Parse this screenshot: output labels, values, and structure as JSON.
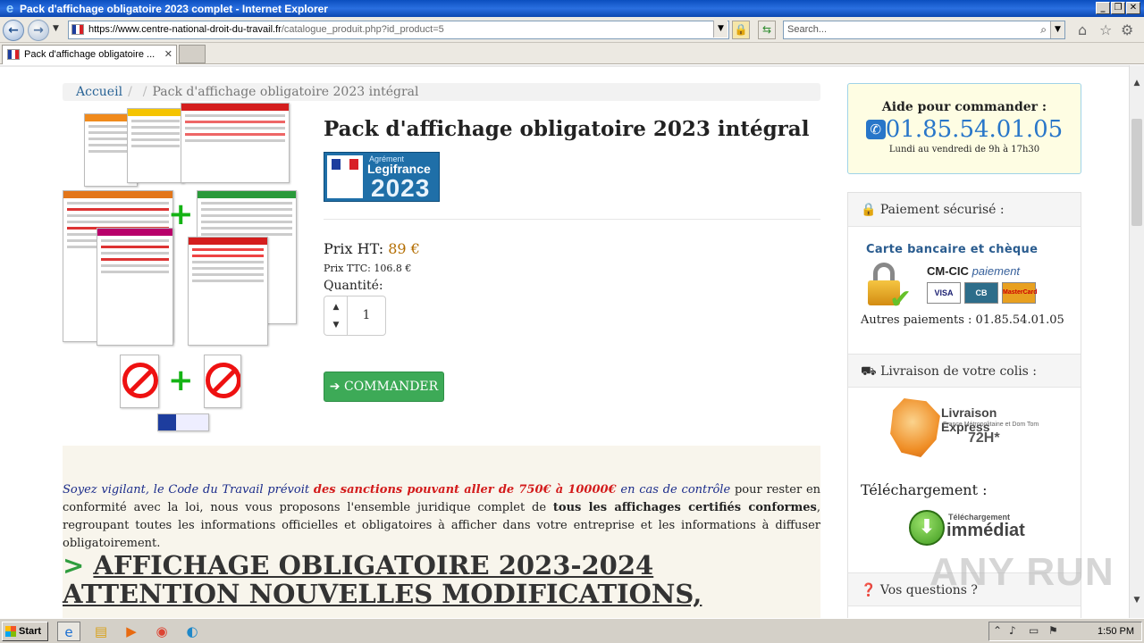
{
  "window": {
    "title": "Pack d'affichage obligatoire 2023 complet - Internet Explorer",
    "minimize": "_",
    "restore": "❐",
    "close": "✕"
  },
  "address_bar": {
    "url_host": "https://www.centre-national-droit-du-travail.fr",
    "url_path": "/catalogue_produit.php?id_product=5",
    "search_placeholder": "Search..."
  },
  "tabs": [
    {
      "label": "Pack d'affichage obligatoire ..."
    }
  ],
  "breadcrumb": {
    "home": "Accueil",
    "sep1": "/",
    "sep2": "/",
    "current": "Pack d'affichage obligatoire 2023 intégral"
  },
  "product": {
    "title": "Pack d'affichage obligatoire 2023 intégral",
    "badge": {
      "label": "Agrément",
      "brand": "Legifrance",
      "year": "2023"
    },
    "price_ht_label": "Prix HT:",
    "price_ht_value": "89 €",
    "price_ttc": "Prix TTC: 106.8 €",
    "quantity_label": "Quantité:",
    "quantity_value": "1",
    "order_button": "COMMANDER"
  },
  "description": {
    "p1_intro": "Soyez vigilant, le Code du Travail prévoit",
    "p1_red": "des sanctions pouvant aller de 750€ à 10000€",
    "p1_mid": "en cas de contrôle",
    "p1_rest": "pour rester en conformité avec la loi, nous vous proposons l'ensemble juridique complet de",
    "p1_bold": "tous les affichages certifiés conformes",
    "p1_end": ", regroupant toutes les informations officielles et obligatoires à afficher dans votre entreprise et les informations à diffuser obligatoirement.",
    "headline_marker": ">",
    "headline": "AFFICHAGE OBLIGATOIRE 2023-2024 ATTENTION NOUVELLES MODIFICATIONS,"
  },
  "sidebar": {
    "help_title": "Aide pour commander :",
    "help_phone": "01.85.54.01.05",
    "help_hours": "Lundi au vendredi de 9h à 17h30",
    "payment_header": "Paiement sécurisé :",
    "payment_cb_title": "Carte bancaire et chèque",
    "payment_provider": "CM-CIC",
    "payment_provider_suffix": "paiement",
    "cards": [
      "VISA",
      "CB",
      "MasterCard"
    ],
    "other_payments": "Autres paiements : 01.85.54.01.05",
    "delivery_header": "Livraison de votre colis :",
    "delivery_title": "Livraison Express",
    "delivery_sub": "France Métropolitaine et Dom Tom",
    "delivery_time": "72H*",
    "download_title": "Téléchargement :",
    "download_small": "Téléchargement",
    "download_big": "immédiat",
    "questions_header": "Vos questions ?"
  },
  "watermark": "ANY RUN",
  "taskbar": {
    "start": "Start",
    "clock": "1:50 PM"
  }
}
